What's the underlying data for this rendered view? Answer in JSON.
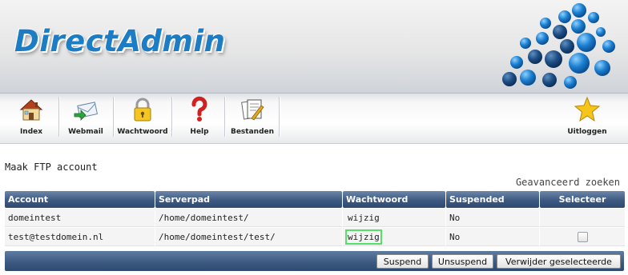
{
  "header": {
    "logo_text": "DirectAdmin"
  },
  "toolbar": {
    "items": [
      {
        "label": "Index",
        "icon": "house-icon"
      },
      {
        "label": "Webmail",
        "icon": "mail-icon"
      },
      {
        "label": "Wachtwoord",
        "icon": "lock-icon"
      },
      {
        "label": "Help",
        "icon": "question-icon"
      },
      {
        "label": "Bestanden",
        "icon": "files-icon"
      }
    ],
    "logout": {
      "label": "Uitloggen",
      "icon": "star-icon"
    }
  },
  "page": {
    "heading": "Maak FTP account",
    "advanced_search": "Geavanceerd zoeken"
  },
  "table": {
    "headers": [
      "Account",
      "Serverpad",
      "Wachtwoord",
      "Suspended",
      "Selecteer"
    ],
    "rows": [
      {
        "account": "domeintest",
        "path": "/home/domeintest/",
        "password_link": "wijzig",
        "suspended": "No"
      },
      {
        "account": "test@testdomein.nl",
        "path": "/home/domeintest/test/",
        "password_link": "wijzig",
        "suspended": "No"
      }
    ]
  },
  "actions": {
    "suspend": "Suspend",
    "unsuspend": "Unsuspend",
    "delete_selected": "Verwijder geselecteerde"
  },
  "colors": {
    "logo_blue": "#1c7dc4",
    "table_header": "#3e5a82",
    "highlight": "#55e06a"
  }
}
